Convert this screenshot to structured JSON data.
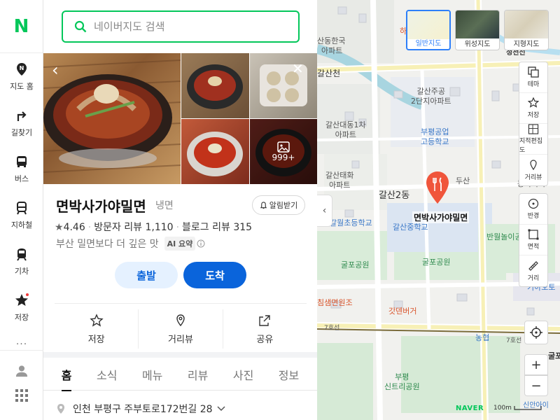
{
  "nav": {
    "logo": "N",
    "items": [
      {
        "label": "지도 홈",
        "icon": "map-pin-icon"
      },
      {
        "label": "길찾기",
        "icon": "directions-icon"
      },
      {
        "label": "버스",
        "icon": "bus-icon"
      },
      {
        "label": "지하철",
        "icon": "subway-icon"
      },
      {
        "label": "기차",
        "icon": "train-icon"
      },
      {
        "label": "저장",
        "icon": "star-icon"
      }
    ],
    "more": "···"
  },
  "search": {
    "placeholder": "네이버지도 검색"
  },
  "photos": {
    "more_count": "999+"
  },
  "place": {
    "name": "면박사가야밀면",
    "category": "냉면",
    "alarm_label": "알림받기",
    "rating": "4.46",
    "visitor_reviews": "방문자 리뷰 1,110",
    "blog_reviews": "블로그 리뷰 315",
    "description": "부산 밀면보다 더 깊은 맛",
    "ai_badge": "AI 요약",
    "depart_label": "출발",
    "arrive_label": "도착",
    "actions": [
      {
        "label": "저장",
        "icon": "star-outline-icon"
      },
      {
        "label": "거리뷰",
        "icon": "street-view-icon"
      },
      {
        "label": "공유",
        "icon": "share-icon"
      }
    ],
    "tabs": [
      "홈",
      "소식",
      "메뉴",
      "리뷰",
      "사진",
      "정보"
    ],
    "active_tab": "홈",
    "address": "인천 부평구 주부토로172번길 28"
  },
  "map": {
    "layers": [
      {
        "label": "일반지도",
        "active": true
      },
      {
        "label": "위성지도",
        "active": false
      },
      {
        "label": "지형지도",
        "active": false
      }
    ],
    "tools": [
      {
        "label": "테마",
        "icon": "theme-icon"
      },
      {
        "label": "저장",
        "icon": "star-icon"
      },
      {
        "label": "지적편집도",
        "icon": "cadastral-icon"
      },
      {
        "label": "거리뷰",
        "icon": "street-view-icon"
      }
    ],
    "tools2": [
      {
        "label": "반경",
        "icon": "radius-icon"
      },
      {
        "label": "면적",
        "icon": "area-icon"
      },
      {
        "label": "거리",
        "icon": "ruler-icon"
      }
    ],
    "labels": {
      "galsancheon": "갈산천",
      "apt1": "갈산주공\n2단지아파트",
      "apt2": "갈산대동1차\n아파트",
      "school1": "부평공업\n고등학교",
      "apt3": "갈산태화\n아파트",
      "galsan2dong": "갈산2동",
      "dusan": "두산",
      "donga": "동아아파",
      "elem": "갈월초등학교",
      "middle": "갈산중학교",
      "park1": "반월놀이공",
      "park2": "굴포공원",
      "park3": "굴포공원",
      "restaurant": "침샘면원조",
      "burger": "갓덴버거",
      "nonghyup": "농협",
      "line7a": "7호선",
      "line7b": "7호선",
      "park4": "부평\n신트리공원",
      "station": "기아오토",
      "station2": "굴포",
      "station3": "신안아이",
      "top1": "산동한국",
      "top2": "아파트",
      "top3": "정천선",
      "top4": "하",
      "pin_label": "면박사가야밀면",
      "scale": "100m",
      "naver": "NAVER"
    }
  }
}
